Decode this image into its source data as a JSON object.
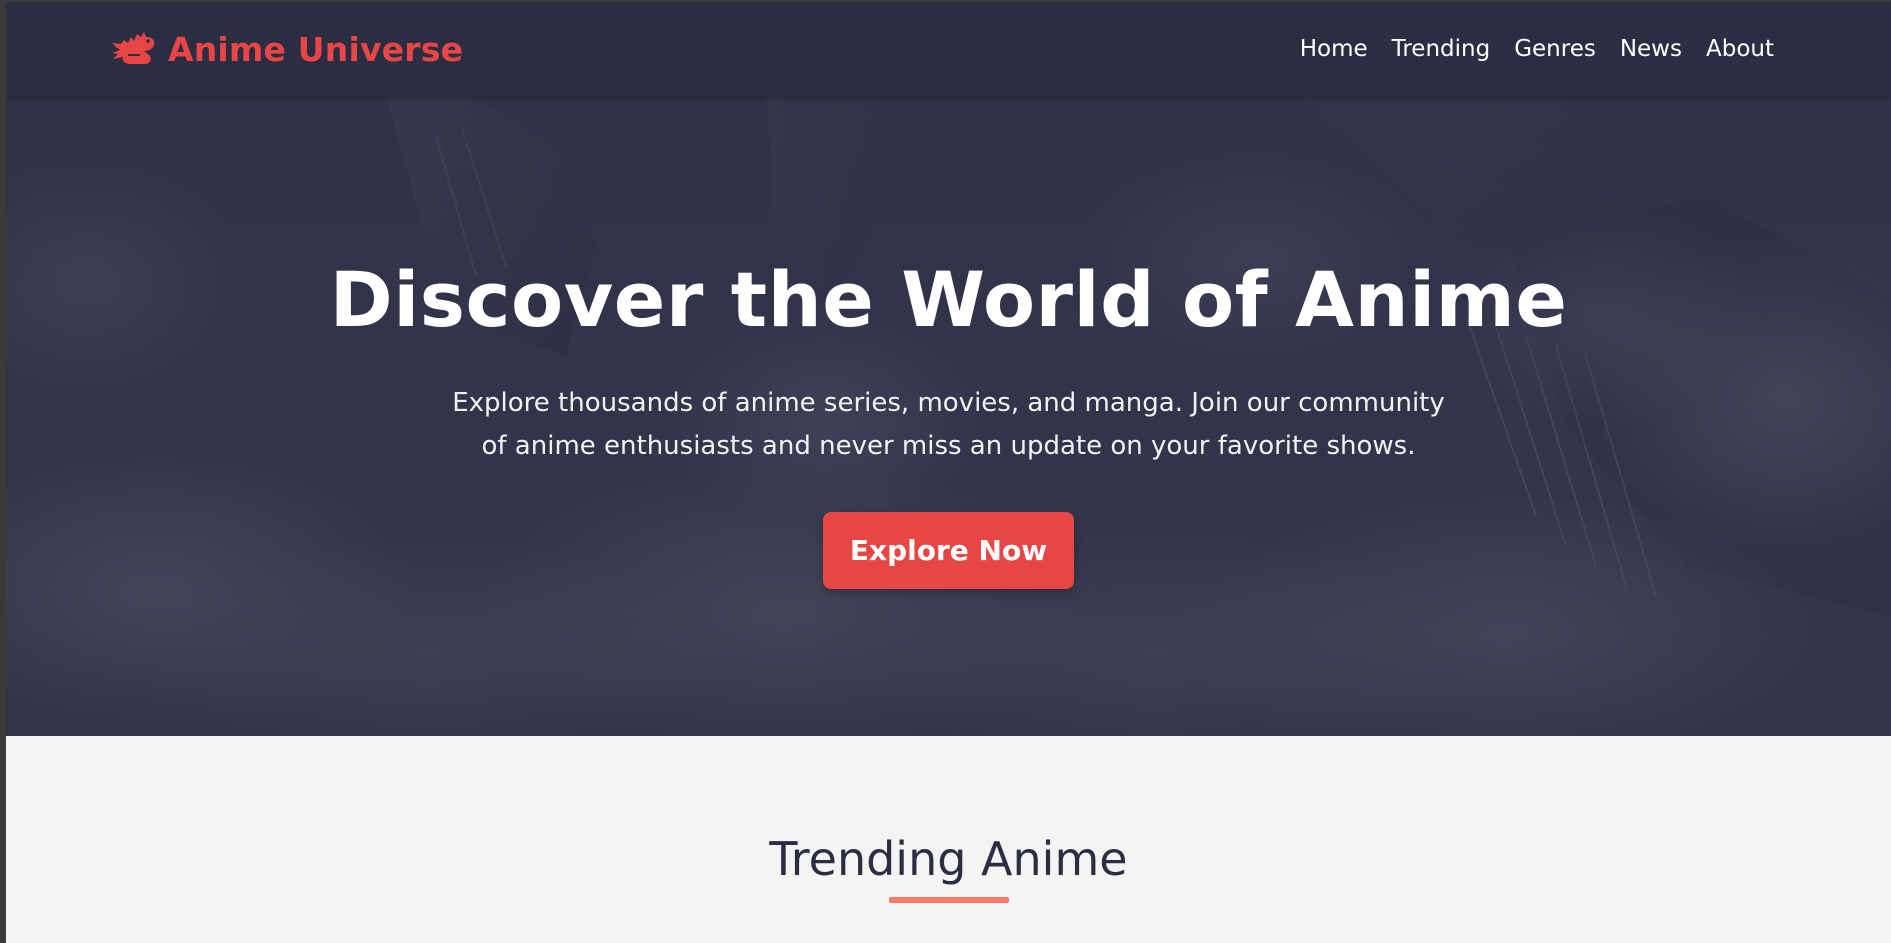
{
  "brand": {
    "name": "Anime Universe",
    "logo_icon": "dragon-icon",
    "accent_color": "#e84545"
  },
  "nav": {
    "items": [
      {
        "label": "Home"
      },
      {
        "label": "Trending"
      },
      {
        "label": "Genres"
      },
      {
        "label": "News"
      },
      {
        "label": "About"
      }
    ]
  },
  "hero": {
    "title": "Discover the World of Anime",
    "subtitle": "Explore thousands of anime series, movies, and manga. Join our community of anime enthusiasts and never miss an update on your favorite shows.",
    "cta_label": "Explore Now",
    "background": "mountain-clouds-image"
  },
  "trending": {
    "title": "Trending Anime",
    "underline_color": "#f47c62"
  },
  "colors": {
    "navbar": "#2b2d42",
    "page_background": "#f4f4f4",
    "heading": "#2b2d42"
  }
}
